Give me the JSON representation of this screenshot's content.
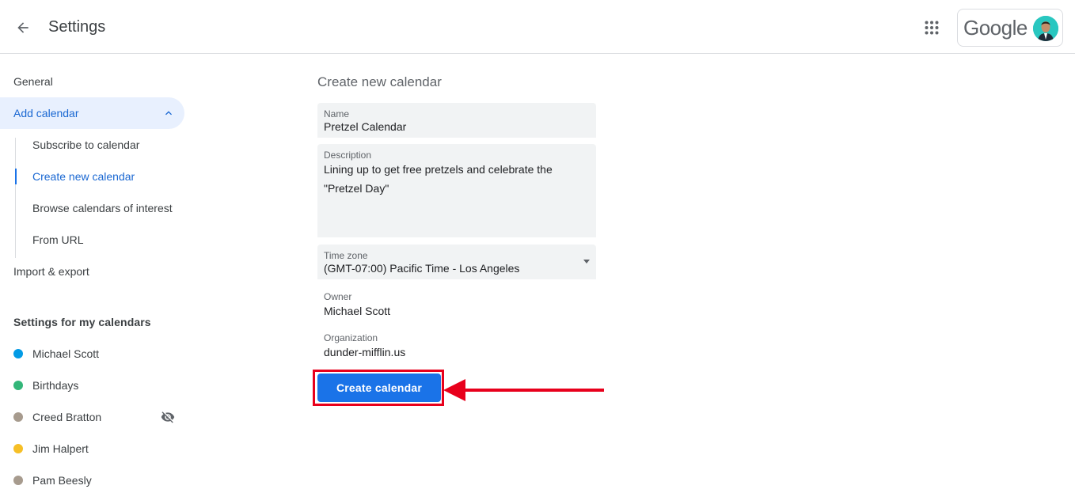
{
  "header": {
    "title": "Settings",
    "back_icon": "arrow-back-icon",
    "apps_icon": "apps-grid-icon",
    "logo_text": "Google"
  },
  "sidebar": {
    "general": "General",
    "add_calendar": "Add calendar",
    "sub_items": [
      "Subscribe to calendar",
      "Create new calendar",
      "Browse calendars of interest",
      "From URL"
    ],
    "import_export": "Import & export",
    "section_title": "Settings for my calendars",
    "calendars": [
      {
        "name": "Michael Scott",
        "color": "#039be5"
      },
      {
        "name": "Birthdays",
        "color": "#33b679"
      },
      {
        "name": "Creed Bratton",
        "color": "#a79b8e",
        "hidden": true
      },
      {
        "name": "Jim Halpert",
        "color": "#f6bf26"
      },
      {
        "name": "Pam Beesly",
        "color": "#a79b8e"
      }
    ]
  },
  "form": {
    "title": "Create new calendar",
    "name_label": "Name",
    "name_value": "Pretzel Calendar",
    "description_label": "Description",
    "description_value": "Lining up to get free pretzels and celebrate the \"Pretzel Day\"",
    "timezone_label": "Time zone",
    "timezone_value": "(GMT-07:00) Pacific Time - Los Angeles",
    "owner_label": "Owner",
    "owner_value": "Michael Scott",
    "org_label": "Organization",
    "org_value": "dunder-mifflin.us",
    "create_button": "Create calendar"
  },
  "colors": {
    "accent": "#1a73e8",
    "active_bg": "#e8f0fe",
    "annotation": "#e8001c"
  }
}
